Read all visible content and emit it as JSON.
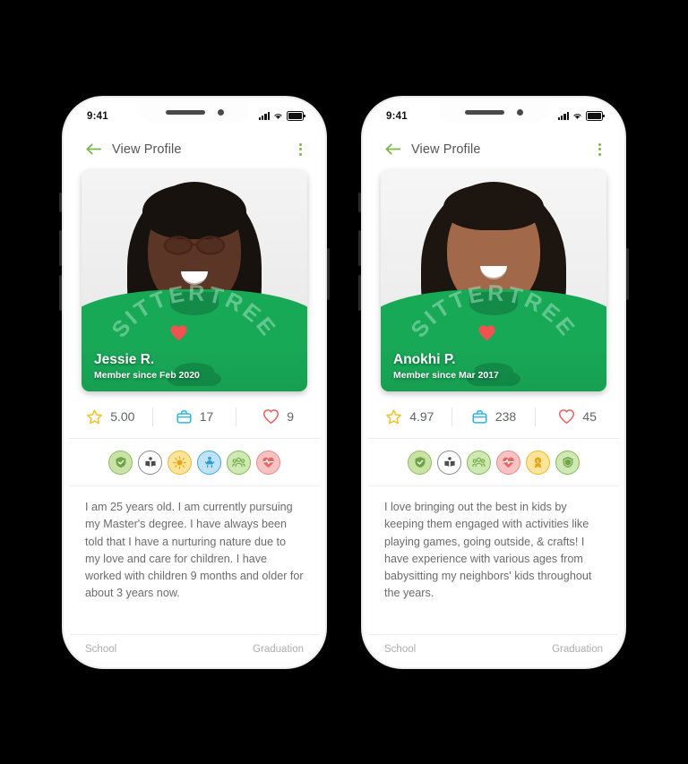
{
  "background_color": "#000000",
  "accent_green": "#7ab648",
  "brand_green": "#18a957",
  "star_color": "#f5c025",
  "briefcase_color": "#29b6e8",
  "heart_color": "#ef5d5d",
  "phones": [
    {
      "status_bar": {
        "time": "9:41",
        "signal_icon": "cellular-signal-icon",
        "wifi_icon": "wifi-icon",
        "battery_icon": "battery-icon"
      },
      "header": {
        "back_icon": "back-arrow-icon",
        "title": "View Profile",
        "menu_icon": "kebab-menu-icon"
      },
      "photo": {
        "name": "Jessie R.",
        "member_since": "Member since Feb 2020",
        "shirt_text": "SITTERTREE",
        "logo_icon": "heart-logo-icon"
      },
      "stats": [
        {
          "icon": "star-icon",
          "value": "5.00",
          "label": "rating"
        },
        {
          "icon": "briefcase-icon",
          "value": "17",
          "label": "jobs"
        },
        {
          "icon": "heart-icon",
          "value": "9",
          "label": "favorites"
        }
      ],
      "badges": [
        {
          "icon": "shield-check-icon",
          "fill": "#c9e3a6",
          "stroke": "#6fa644",
          "glyph": "#6fa644"
        },
        {
          "icon": "book-reader-icon",
          "fill": "#ffffff",
          "stroke": "#8b8b8b",
          "glyph": "#4c4c4c"
        },
        {
          "icon": "sun-icon",
          "fill": "#fce49a",
          "stroke": "#e8b930",
          "glyph": "#e8a418"
        },
        {
          "icon": "baby-icon",
          "fill": "#bfe3f5",
          "stroke": "#3fa8dd",
          "glyph": "#2e9bd4"
        },
        {
          "icon": "group-people-icon",
          "fill": "#cfe8b4",
          "stroke": "#83bb55",
          "glyph": "#78b14a"
        },
        {
          "icon": "heart-pulse-icon",
          "fill": "#f6c2c2",
          "stroke": "#e78a8a",
          "glyph": "#e06a6a"
        }
      ],
      "bio": "I am 25 years old. I am currently pursuing my Master's degree. I have always been told that I have a nurturing nature due to my love and care for children. I have worked with children 9 months and older for about 3 years now.",
      "bottom_fields": {
        "left": "School",
        "right": "Graduation"
      }
    },
    {
      "status_bar": {
        "time": "9:41",
        "signal_icon": "cellular-signal-icon",
        "wifi_icon": "wifi-icon",
        "battery_icon": "battery-icon"
      },
      "header": {
        "back_icon": "back-arrow-icon",
        "title": "View Profile",
        "menu_icon": "kebab-menu-icon"
      },
      "photo": {
        "name": "Anokhi P.",
        "member_since": "Member since Mar 2017",
        "shirt_text": "SITTERTREE",
        "logo_icon": "heart-logo-icon"
      },
      "stats": [
        {
          "icon": "star-icon",
          "value": "4.97",
          "label": "rating"
        },
        {
          "icon": "briefcase-icon",
          "value": "238",
          "label": "jobs"
        },
        {
          "icon": "heart-icon",
          "value": "45",
          "label": "favorites"
        }
      ],
      "badges": [
        {
          "icon": "shield-check-icon",
          "fill": "#c9e3a6",
          "stroke": "#6fa644",
          "glyph": "#6fa644"
        },
        {
          "icon": "book-reader-icon",
          "fill": "#ffffff",
          "stroke": "#8b8b8b",
          "glyph": "#4c4c4c"
        },
        {
          "icon": "group-people-icon",
          "fill": "#cfe8b4",
          "stroke": "#83bb55",
          "glyph": "#78b14a"
        },
        {
          "icon": "heart-pulse-icon",
          "fill": "#f6c2c2",
          "stroke": "#e78a8a",
          "glyph": "#e06a6a"
        },
        {
          "icon": "medal-award-icon",
          "fill": "#fce49a",
          "stroke": "#e8b930",
          "glyph": "#e8a418"
        },
        {
          "icon": "shield-badge-icon",
          "fill": "#cfe8b4",
          "stroke": "#83bb55",
          "glyph": "#6fa644"
        }
      ],
      "bio": "I love bringing out the best in kids by keeping them engaged with activities like playing games, going outside, & crafts! I have experience with various ages from babysitting my neighbors' kids throughout the years.",
      "bottom_fields": {
        "left": "School",
        "right": "Graduation"
      }
    }
  ]
}
